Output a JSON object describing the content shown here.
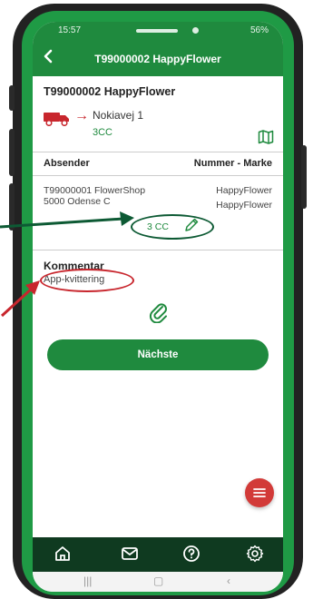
{
  "status": {
    "time": "15:57",
    "battery": "56%"
  },
  "header": {
    "title": "T99000002 HappyFlower"
  },
  "info": {
    "title": "T99000002 HappyFlower",
    "address": "Nokiavej 1",
    "code": "3CC"
  },
  "table": {
    "col_left": "Absender",
    "col_right": "Nummer - Marke",
    "sender_line1": "T99000001 FlowerShop",
    "sender_line2": "5000 Odense C",
    "brand_line1": "HappyFlower",
    "brand_line2": "HappyFlower",
    "quantity": "3 CC"
  },
  "comment": {
    "label": "Kommentar",
    "value": "App-kvittering"
  },
  "actions": {
    "next_label": "Nächste"
  },
  "colors": {
    "primary": "#1f8a3e",
    "dark_nav": "#0f3a20",
    "accent_red": "#d23a38",
    "frame_green": "#1f9a45"
  },
  "icons": {
    "nav": [
      "home-icon",
      "mail-icon",
      "help-icon",
      "settings-icon"
    ],
    "system_nav": [
      "recent-apps-icon",
      "home-button-icon",
      "back-icon"
    ]
  }
}
